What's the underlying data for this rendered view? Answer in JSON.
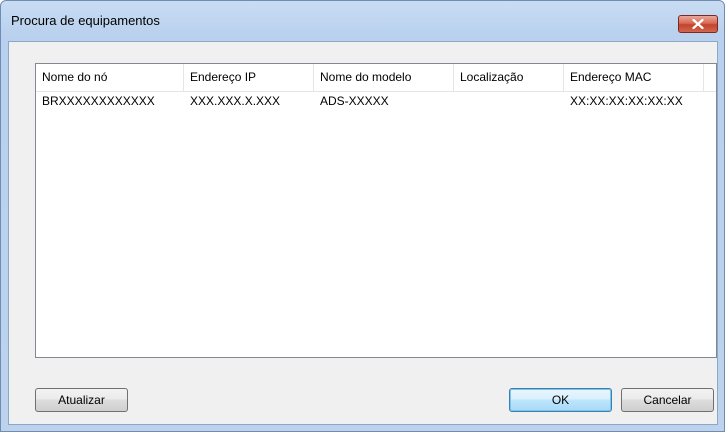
{
  "window": {
    "title": "Procura de equipamentos"
  },
  "icons": {
    "close": "close-icon"
  },
  "colors": {
    "titlebar": "#b9d1ee",
    "close_button": "#c2432d",
    "default_button_border": "#3c7fb1",
    "client_background": "#f0f0f0"
  },
  "device_list": {
    "columns": [
      {
        "label": "Nome do nó"
      },
      {
        "label": "Endereço IP"
      },
      {
        "label": "Nome do modelo"
      },
      {
        "label": "Localização"
      },
      {
        "label": "Endereço MAC"
      }
    ],
    "rows": [
      {
        "node_name": "BRXXXXXXXXXXXX",
        "ip_address": "XXX.XXX.X.XXX",
        "model_name": "ADS-XXXXX",
        "location": "",
        "mac_address": "XX:XX:XX:XX:XX:XX"
      }
    ]
  },
  "buttons": {
    "refresh": "Atualizar",
    "ok": "OK",
    "cancel": "Cancelar"
  }
}
